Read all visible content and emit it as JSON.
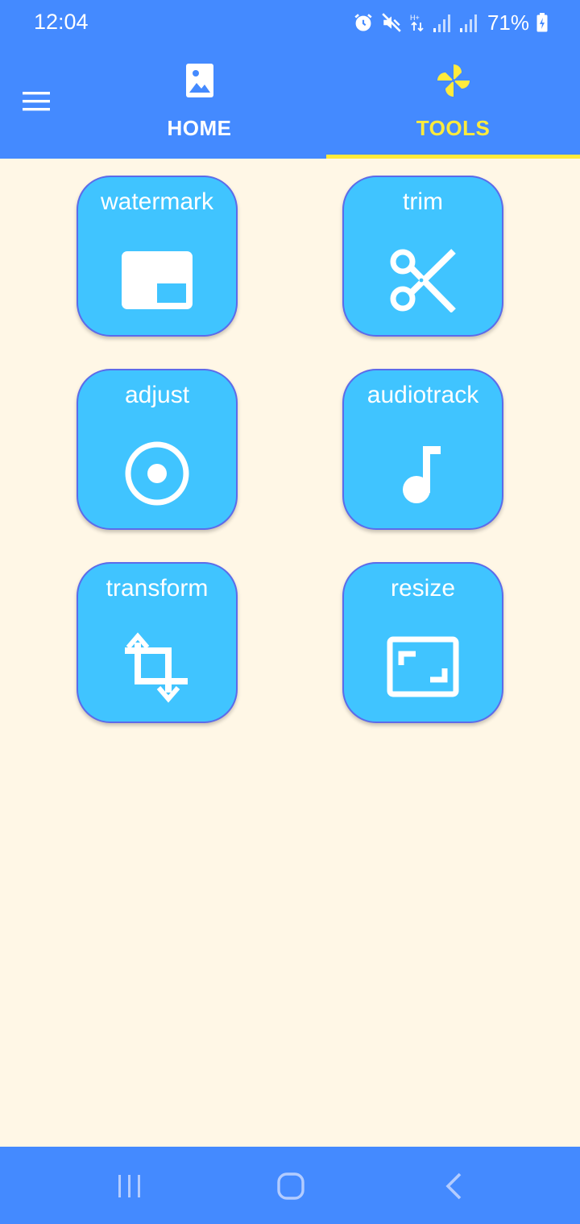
{
  "status_bar": {
    "time": "12:04",
    "battery": "71%",
    "icons": [
      "alarm-icon",
      "mute-icon",
      "data-arrows-icon",
      "signal-icon",
      "signal-icon",
      "battery-charging-icon"
    ]
  },
  "app_bar": {
    "menu_icon": "hamburger-menu-icon",
    "tabs": [
      {
        "label": "HOME",
        "icon": "image-icon",
        "active": false
      },
      {
        "label": "TOOLS",
        "icon": "pinwheel-icon",
        "active": true
      }
    ]
  },
  "tools": [
    {
      "label": "watermark",
      "icon": "watermark-icon"
    },
    {
      "label": "trim",
      "icon": "scissors-icon"
    },
    {
      "label": "adjust",
      "icon": "adjust-icon"
    },
    {
      "label": "audiotrack",
      "icon": "music-note-icon"
    },
    {
      "label": "transform",
      "icon": "crop-rotate-icon"
    },
    {
      "label": "resize",
      "icon": "aspect-ratio-icon"
    }
  ],
  "colors": {
    "primary": "#448AFF",
    "accent": "#FFEB3B",
    "tile": "#40C4FF",
    "tile_border": "#5C6BEA",
    "background": "#FFF7E6"
  },
  "nav_bar": {
    "buttons": [
      "recent-apps-icon",
      "home-icon",
      "back-icon"
    ]
  }
}
